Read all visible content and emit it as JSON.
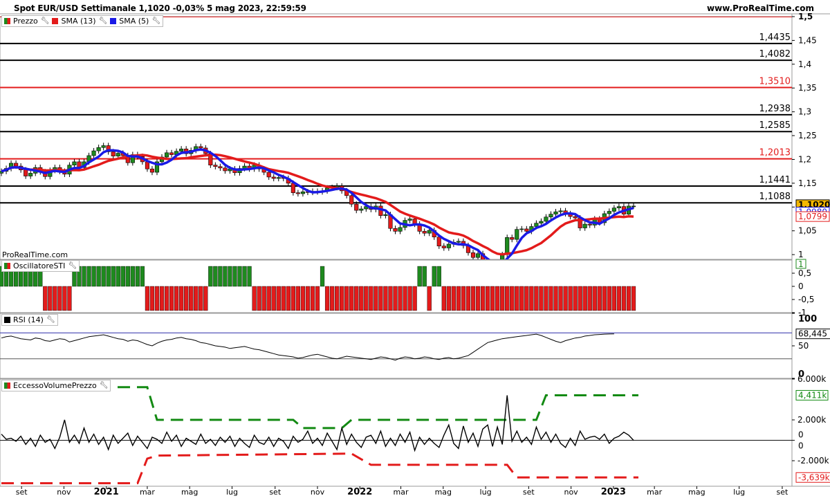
{
  "header": {
    "title": "Spot EUR/USD Settimanale 1,1020 -0,03% 5 mag 2023, 22:59:59",
    "site": "www.ProRealTime.com",
    "watermark": "ProRealTime.com"
  },
  "legends": {
    "price": "Prezzo",
    "sma13": "SMA (13)",
    "sma5": "SMA (5)",
    "sti": "OscillatoreSTI",
    "rsi": "RSI (14)",
    "evp": "EccessoVolumePrezzo"
  },
  "colors": {
    "up": "#1e8a1e",
    "down": "#e31b1b",
    "sma13": "#e31b1b",
    "sma5": "#1a1ae6",
    "evp_upper": "#138a13",
    "evp_lower": "#e31b1b",
    "badge_price": "#f5b800"
  },
  "chart_data": [
    {
      "type": "candlestick",
      "title": "Spot EUR/USD Settimanale",
      "ylim": [
        0.99,
        1.5
      ],
      "y_ticks": [
        "1,5",
        "1,45",
        "1,4",
        "1,35",
        "1,3",
        "1,25",
        "1,2",
        "1,15",
        "1,1",
        "1,05",
        "1"
      ],
      "x_ticks": [
        "set",
        "nov",
        "2021",
        "mar",
        "mag",
        "lug",
        "set",
        "nov",
        "2022",
        "mar",
        "mag",
        "lug",
        "set",
        "nov",
        "2023",
        "mar",
        "mag",
        "lug",
        "set"
      ],
      "x_tick_dates": [
        "2020-09-01",
        "2020-11-01",
        "2021-01-01",
        "2021-03-01",
        "2021-05-01",
        "2021-07-01",
        "2021-09-01",
        "2021-11-01",
        "2022-01-01",
        "2022-03-01",
        "2022-05-01",
        "2022-07-01",
        "2022-09-01",
        "2022-11-01",
        "2023-01-01",
        "2023-03-01",
        "2023-05-01",
        "2023-07-01",
        "2023-09-01"
      ],
      "x_range": [
        "2020-08-01",
        "2023-09-15"
      ],
      "weeks_start": "2020-08-03",
      "closes": [
        1.175,
        1.181,
        1.192,
        1.186,
        1.178,
        1.165,
        1.171,
        1.183,
        1.174,
        1.164,
        1.177,
        1.183,
        1.175,
        1.169,
        1.188,
        1.195,
        1.183,
        1.195,
        1.208,
        1.218,
        1.225,
        1.229,
        1.216,
        1.207,
        1.213,
        1.208,
        1.193,
        1.21,
        1.206,
        1.195,
        1.18,
        1.173,
        1.195,
        1.205,
        1.214,
        1.21,
        1.217,
        1.222,
        1.212,
        1.219,
        1.227,
        1.224,
        1.212,
        1.188,
        1.185,
        1.182,
        1.176,
        1.18,
        1.172,
        1.181,
        1.186,
        1.18,
        1.188,
        1.18,
        1.173,
        1.163,
        1.16,
        1.162,
        1.16,
        1.15,
        1.13,
        1.128,
        1.132,
        1.131,
        1.133,
        1.132,
        1.134,
        1.14,
        1.141,
        1.144,
        1.134,
        1.124,
        1.106,
        1.093,
        1.096,
        1.101,
        1.095,
        1.102,
        1.082,
        1.084,
        1.055,
        1.049,
        1.057,
        1.072,
        1.075,
        1.064,
        1.049,
        1.045,
        1.051,
        1.037,
        1.018,
        1.014,
        1.022,
        1.026,
        1.028,
        1.019,
        1.004,
        0.994,
        1.002,
        0.975,
        0.98,
        0.967,
        0.975,
        1.0,
        1.036,
        1.032,
        1.053,
        1.054,
        1.049,
        1.059,
        1.066,
        1.07,
        1.079,
        1.085,
        1.09,
        1.092,
        1.086,
        1.08,
        1.077,
        1.056,
        1.064,
        1.062,
        1.075,
        1.067,
        1.086,
        1.091,
        1.098,
        1.101,
        1.085,
        1.102,
        1.102
      ],
      "sma5_end": 1.098,
      "sma13_end": 1.0799,
      "series": [
        {
          "name": "Prezzo"
        },
        {
          "name": "SMA (13)",
          "last": "1,0799"
        },
        {
          "name": "SMA (5)",
          "last": "1,0980"
        }
      ],
      "hlines": [
        {
          "value": 1.5,
          "label": "",
          "color": "#e31b1b"
        },
        {
          "value": 1.4435,
          "label": "1,4435",
          "color": "#000000"
        },
        {
          "value": 1.4082,
          "label": "1,4082",
          "color": "#000000"
        },
        {
          "value": 1.351,
          "label": "1,3510",
          "color": "#e31b1b"
        },
        {
          "value": 1.2938,
          "label": "1,2938",
          "color": "#000000"
        },
        {
          "value": 1.2585,
          "label": "1,2585",
          "color": "#000000"
        },
        {
          "value": 1.2013,
          "label": "1,2013",
          "color": "#e31b1b"
        },
        {
          "value": 1.1441,
          "label": "1,1441",
          "color": "#000000"
        },
        {
          "value": 1.1088,
          "label": "1,1088",
          "color": "#000000"
        }
      ],
      "last_price": "1,1020"
    },
    {
      "type": "bar",
      "title": "OscillatoreSTI",
      "ylim": [
        -1,
        1
      ],
      "y_ticks": [
        "1",
        "0,5",
        "0",
        "-0,5",
        "-1"
      ],
      "last_value": "1",
      "signals_start": "2020-08-03",
      "signals": [
        1,
        1,
        1,
        1,
        1,
        1,
        1,
        1,
        1,
        -1,
        -1,
        -1,
        -1,
        -1,
        -1,
        1,
        1,
        1,
        1,
        1,
        1,
        1,
        1,
        1,
        1,
        1,
        1,
        1,
        1,
        1,
        -1,
        -1,
        -1,
        -1,
        -1,
        -1,
        -1,
        -1,
        -1,
        -1,
        -1,
        -1,
        -1,
        1,
        1,
        1,
        1,
        1,
        1,
        1,
        1,
        1,
        -1,
        -1,
        -1,
        -1,
        -1,
        -1,
        -1,
        -1,
        -1,
        -1,
        -1,
        -1,
        -1,
        -1,
        1,
        -1,
        -1,
        -1,
        -1,
        -1,
        -1,
        -1,
        -1,
        -1,
        -1,
        -1,
        -1,
        -1,
        -1,
        -1,
        -1,
        -1,
        -1,
        -1,
        1,
        1,
        -1,
        1,
        1,
        -1,
        -1,
        -1,
        -1,
        -1,
        -1,
        -1,
        -1,
        -1,
        -1,
        -1,
        -1,
        -1,
        -1,
        -1,
        -1,
        -1,
        -1,
        -1,
        -1,
        -1,
        -1,
        -1,
        -1,
        -1,
        -1,
        -1,
        -1,
        -1,
        -1,
        -1,
        -1,
        -1,
        -1,
        -1,
        -1,
        -1,
        -1,
        -1,
        -1,
        -1,
        -1,
        -1,
        -1,
        -1,
        -1,
        -1,
        -1,
        -1,
        -1,
        -1,
        -1,
        -1,
        -1,
        -1,
        -1,
        -1,
        -1,
        -1,
        -1,
        -1,
        -1,
        -1,
        -1,
        -1,
        -1,
        -1,
        -1,
        -1,
        -1,
        1,
        1,
        1,
        1,
        1,
        1,
        1,
        1,
        1,
        1,
        1,
        1,
        1,
        1,
        1,
        1,
        1,
        1,
        1,
        -1,
        -1,
        -1,
        -1,
        -1,
        -1,
        1,
        1,
        1,
        1,
        1,
        1,
        1,
        1
      ]
    },
    {
      "type": "line",
      "title": "RSI (14)",
      "ylim": [
        0,
        100
      ],
      "y_ticks": [
        "100",
        "50",
        "0"
      ],
      "reference_lines": [
        70,
        30
      ],
      "last_value": "68,445",
      "values": [
        62,
        64,
        65,
        63,
        61,
        60,
        59,
        62,
        61,
        58,
        57,
        59,
        61,
        60,
        56,
        58,
        60,
        62,
        64,
        65,
        66,
        67,
        65,
        63,
        61,
        60,
        57,
        59,
        58,
        55,
        52,
        50,
        54,
        57,
        59,
        60,
        62,
        63,
        61,
        60,
        58,
        55,
        54,
        52,
        50,
        49,
        48,
        46,
        47,
        48,
        49,
        47,
        45,
        44,
        42,
        40,
        38,
        36,
        35,
        34,
        33,
        31,
        32,
        34,
        36,
        37,
        35,
        33,
        31,
        30,
        32,
        34,
        33,
        32,
        31,
        30,
        29,
        31,
        33,
        32,
        30,
        28,
        31,
        33,
        32,
        30,
        31,
        33,
        32,
        30,
        29,
        31,
        32,
        30,
        31,
        33,
        35,
        40,
        45,
        50,
        55,
        57,
        59,
        61,
        62,
        63,
        64,
        65,
        66,
        67,
        68,
        66,
        63,
        60,
        57,
        55,
        58,
        60,
        62,
        63,
        65,
        66,
        67,
        67.5,
        68,
        68.2,
        68.445
      ]
    },
    {
      "type": "line",
      "title": "EccessoVolumePrezzo",
      "ylim": [
        -4500,
        6000
      ],
      "y_ticks": [
        "6.000k",
        "2.000k",
        "0",
        "-2.000k"
      ],
      "last_upper": "4,411k",
      "last_lower": "-3,639k",
      "extra_ticks": [
        "0",
        "0"
      ],
      "upper": [
        [
          0,
          5200
        ],
        [
          30,
          5200
        ],
        [
          32,
          2000
        ],
        [
          60,
          2000
        ],
        [
          62,
          1200
        ],
        [
          70,
          1200
        ],
        [
          72,
          2000
        ],
        [
          110,
          2000
        ],
        [
          112,
          4411
        ],
        [
          131,
          4411
        ]
      ],
      "lower": [
        [
          0,
          -4200
        ],
        [
          28,
          -4200
        ],
        [
          30,
          -1800
        ],
        [
          32,
          -1500
        ],
        [
          72,
          -1300
        ],
        [
          76,
          -2400
        ],
        [
          104,
          -2400
        ],
        [
          106,
          -3639
        ],
        [
          131,
          -3639
        ]
      ],
      "values": [
        600,
        100,
        200,
        -100,
        400,
        -400,
        200,
        -600,
        500,
        -200,
        100,
        -800,
        300,
        2000,
        -200,
        500,
        -300,
        1200,
        -200,
        600,
        -400,
        300,
        -900,
        500,
        -300,
        200,
        700,
        -500,
        400,
        -200,
        -800,
        300,
        100,
        -300,
        800,
        -100,
        500,
        -600,
        200,
        -100,
        -400,
        600,
        -300,
        100,
        -500,
        300,
        -200,
        400,
        -600,
        200,
        -300,
        -700,
        500,
        -200,
        -400,
        300,
        -600,
        200,
        -100,
        -800,
        400,
        -200,
        100,
        900,
        -300,
        200,
        -500,
        700,
        -100,
        -900,
        1200,
        -400,
        600,
        -200,
        -700,
        300,
        500,
        -300,
        900,
        -600,
        200,
        -500,
        600,
        -200,
        800,
        -1000,
        300,
        -400,
        200,
        -300,
        -700,
        500,
        1500,
        -300,
        -800,
        1400,
        -200,
        700,
        -600,
        1100,
        1500,
        -600,
        1300,
        -400,
        4400,
        -100,
        900,
        -200,
        300,
        -400,
        1300,
        100,
        800,
        -200,
        600,
        -300,
        -700,
        200,
        -500,
        900,
        100,
        300,
        400,
        100,
        600,
        -300,
        200,
        400,
        800,
        500,
        0
      ]
    }
  ]
}
